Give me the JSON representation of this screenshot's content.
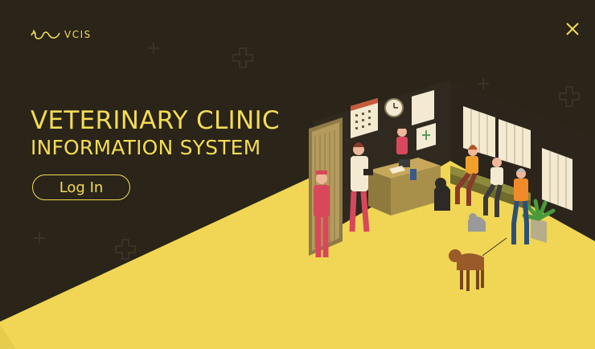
{
  "brand": {
    "name": "VCIS"
  },
  "hero": {
    "title_line1": "VETERINARY CLINIC",
    "title_line2": "INFORMATION SYSTEM"
  },
  "actions": {
    "login_label": "Log In"
  },
  "icons": {
    "close": "close-icon",
    "logo": "cat-logo-icon"
  },
  "colors": {
    "background": "#2a2419",
    "accent": "#f3dc54",
    "floor": "#f0d654"
  }
}
